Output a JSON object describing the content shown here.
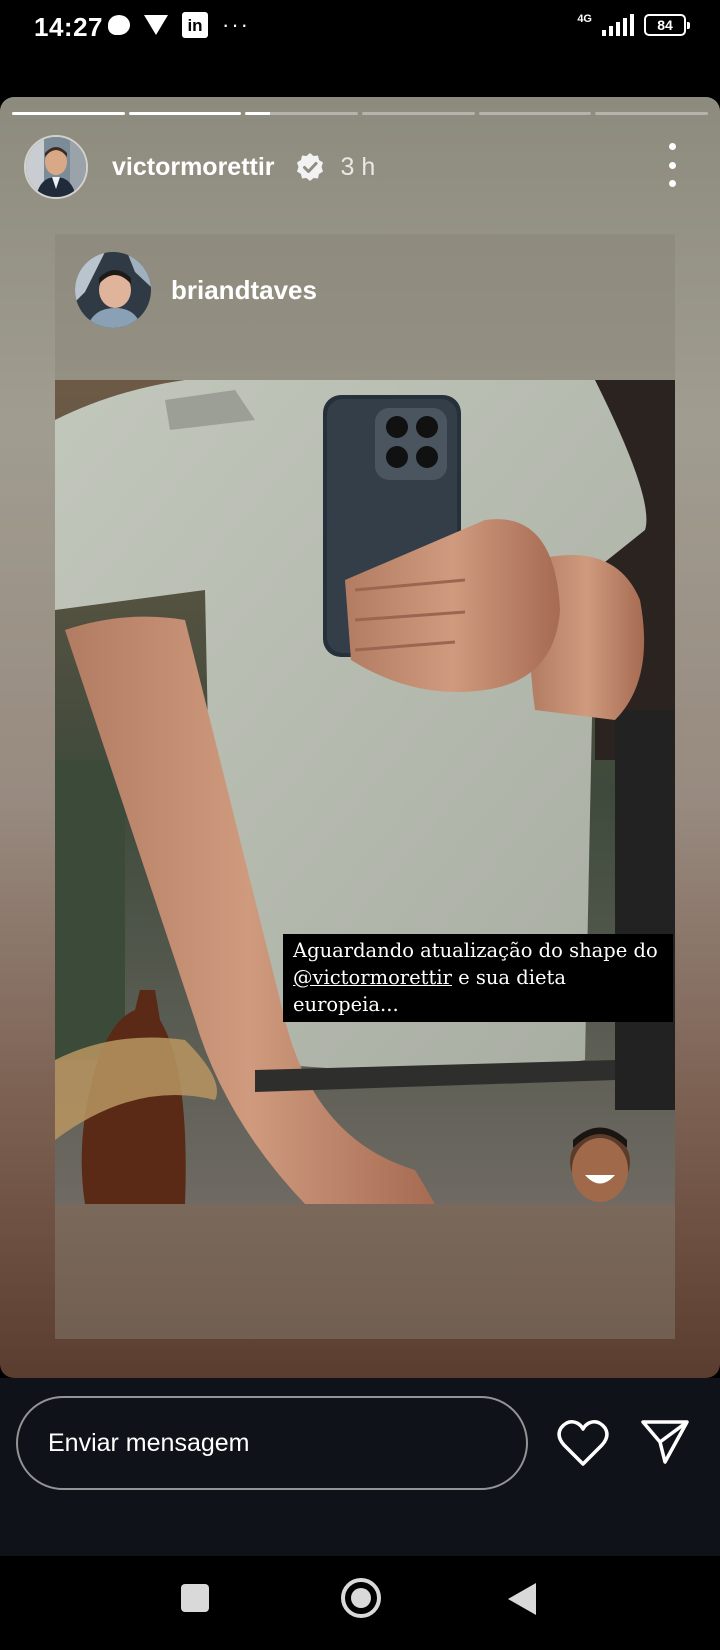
{
  "status_bar": {
    "time": "14:27",
    "dots": "···",
    "linkedin": "in",
    "network": "4G",
    "battery": "84"
  },
  "story": {
    "progress": [
      1,
      1,
      0.22,
      0,
      0,
      0
    ],
    "username": "victormorettir",
    "verified": true,
    "time_ago": "3 h",
    "repost": {
      "username": "briandtaves",
      "caption": {
        "line1": "Aguardando atualização do shape do",
        "mention": "@victormorettir",
        "line2_rest": " e sua dieta europeia..."
      }
    }
  },
  "message_bar": {
    "placeholder": "Enviar mensagem"
  },
  "icons": {
    "status": [
      "chat-bubble-icon",
      "triangle-icon",
      "linkedin-icon",
      "more-dots-icon",
      "signal-icon",
      "battery-icon"
    ],
    "header": [
      "verified-badge-icon",
      "more-options-icon"
    ],
    "message": [
      "heart-icon",
      "send-icon"
    ],
    "nav": [
      "recents-icon",
      "home-icon",
      "back-icon"
    ]
  },
  "colors": {
    "story_top": "#8d8a7e",
    "story_bottom": "#5b3d2f",
    "message_area": "#0f1218"
  }
}
